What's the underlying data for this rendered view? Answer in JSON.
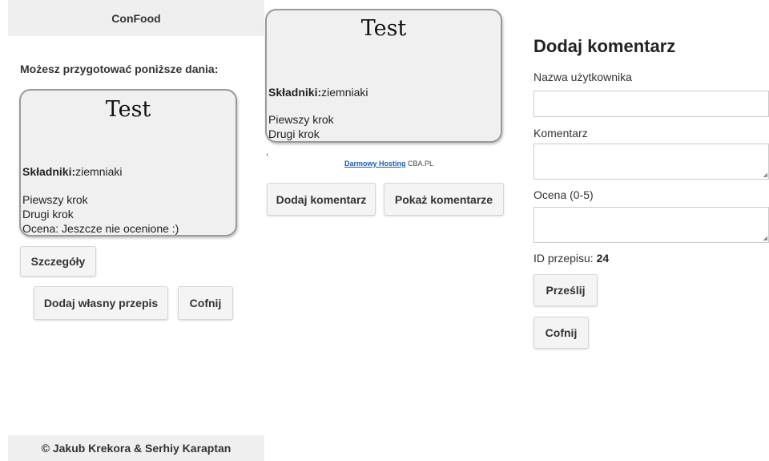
{
  "app": {
    "title": "ConFood",
    "footer": "© Jakub Krekora & Serhiy Karaptan"
  },
  "list_view": {
    "intro": "Możesz przygotować poniższe dania:",
    "card": {
      "title": "Test",
      "ingredients_label": "Składniki:",
      "ingredients_value": "ziemniaki",
      "steps": [
        "Piewszy krok",
        "Drugi krok"
      ],
      "rating": "Ocena: Jeszcze nie ocenione :)"
    },
    "details_button": "Szczegóły",
    "add_recipe_button": "Dodaj własny przepis",
    "back_button": "Cofnij"
  },
  "detail_view": {
    "card": {
      "title": "Test",
      "ingredients_label": "Składniki:",
      "ingredients_value": "ziemniaki",
      "steps": [
        "Piewszy krok",
        "Drugi krok"
      ]
    },
    "stray_mark": ",",
    "hosting_link": "Darmowy Hosting",
    "hosting_suffix": " CBA.PL",
    "add_comment_button": "Dodaj komentarz",
    "show_comments_button": "Pokaż komentarze"
  },
  "comment_form": {
    "title": "Dodaj komentarz",
    "username_label": "Nazwa użytkownika",
    "username_value": "",
    "comment_label": "Komentarz",
    "comment_value": "",
    "rating_label": "Ocena (0-5)",
    "rating_value": "",
    "recipe_id_label": "ID przepisu: ",
    "recipe_id_value": "24",
    "submit_button": "Prześlij",
    "back_button": "Cofnij"
  }
}
